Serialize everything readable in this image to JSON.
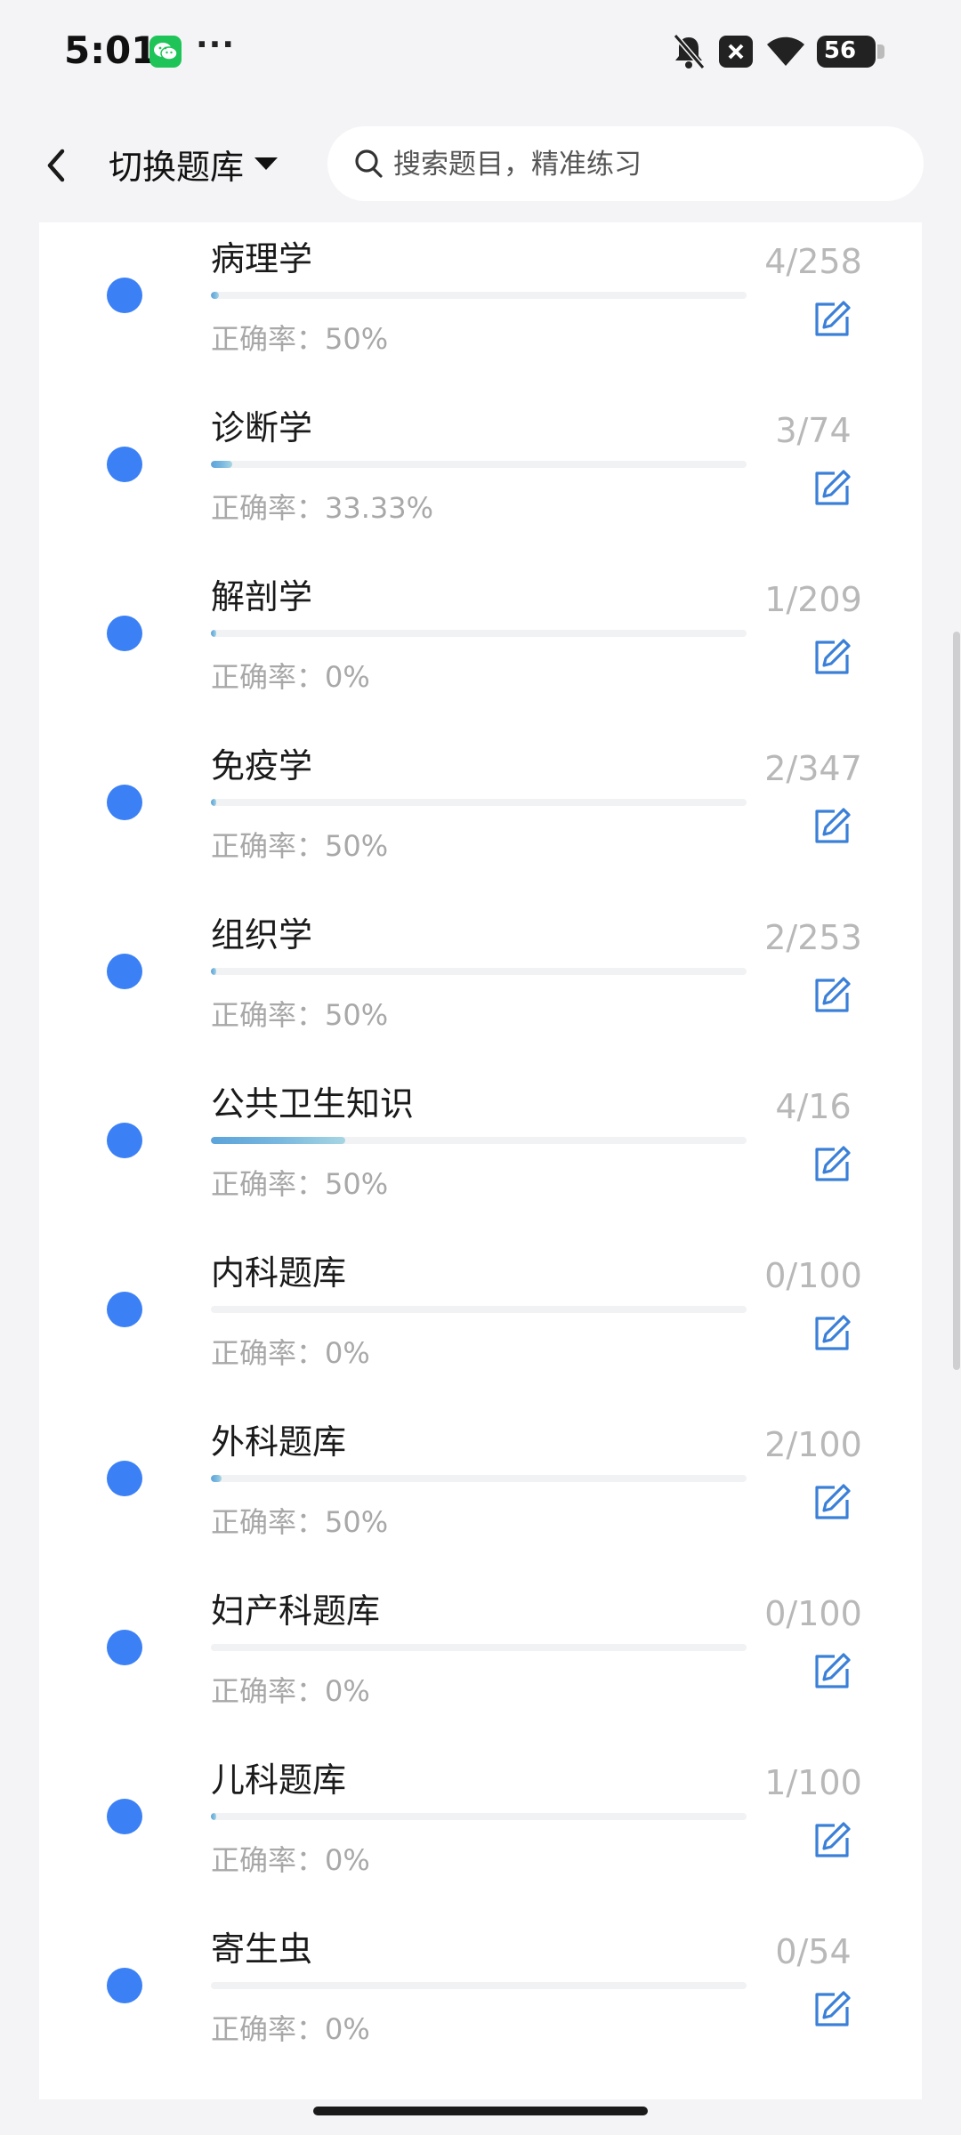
{
  "status_bar": {
    "time": "5:01",
    "more": "···",
    "battery": "56",
    "icons": [
      "wechat-icon",
      "bell-off-icon",
      "close-box-icon",
      "wifi-icon",
      "battery-icon"
    ]
  },
  "header": {
    "switch_label": "切换题库",
    "search_placeholder": "搜索题目，精准练习"
  },
  "accent_color": "#3b80f5",
  "rows": [
    {
      "title": "病理学",
      "count": "4/258",
      "accuracy": "正确率：50%",
      "progress": 0.0155
    },
    {
      "title": "诊断学",
      "count": "3/74",
      "accuracy": "正确率：33.33%",
      "progress": 0.0405
    },
    {
      "title": "解剖学",
      "count": "1/209",
      "accuracy": "正确率：0%",
      "progress": 0.0048
    },
    {
      "title": "免疫学",
      "count": "2/347",
      "accuracy": "正确率：50%",
      "progress": 0.0058
    },
    {
      "title": "组织学",
      "count": "2/253",
      "accuracy": "正确率：50%",
      "progress": 0.0079
    },
    {
      "title": "公共卫生知识",
      "count": "4/16",
      "accuracy": "正确率：50%",
      "progress": 0.25
    },
    {
      "title": "内科题库",
      "count": "0/100",
      "accuracy": "正确率：0%",
      "progress": 0
    },
    {
      "title": "外科题库",
      "count": "2/100",
      "accuracy": "正确率：50%",
      "progress": 0.02
    },
    {
      "title": "妇产科题库",
      "count": "0/100",
      "accuracy": "正确率：0%",
      "progress": 0
    },
    {
      "title": "儿科题库",
      "count": "1/100",
      "accuracy": "正确率：0%",
      "progress": 0.01
    },
    {
      "title": "寄生虫",
      "count": "0/54",
      "accuracy": "正确率：0%",
      "progress": 0
    }
  ]
}
